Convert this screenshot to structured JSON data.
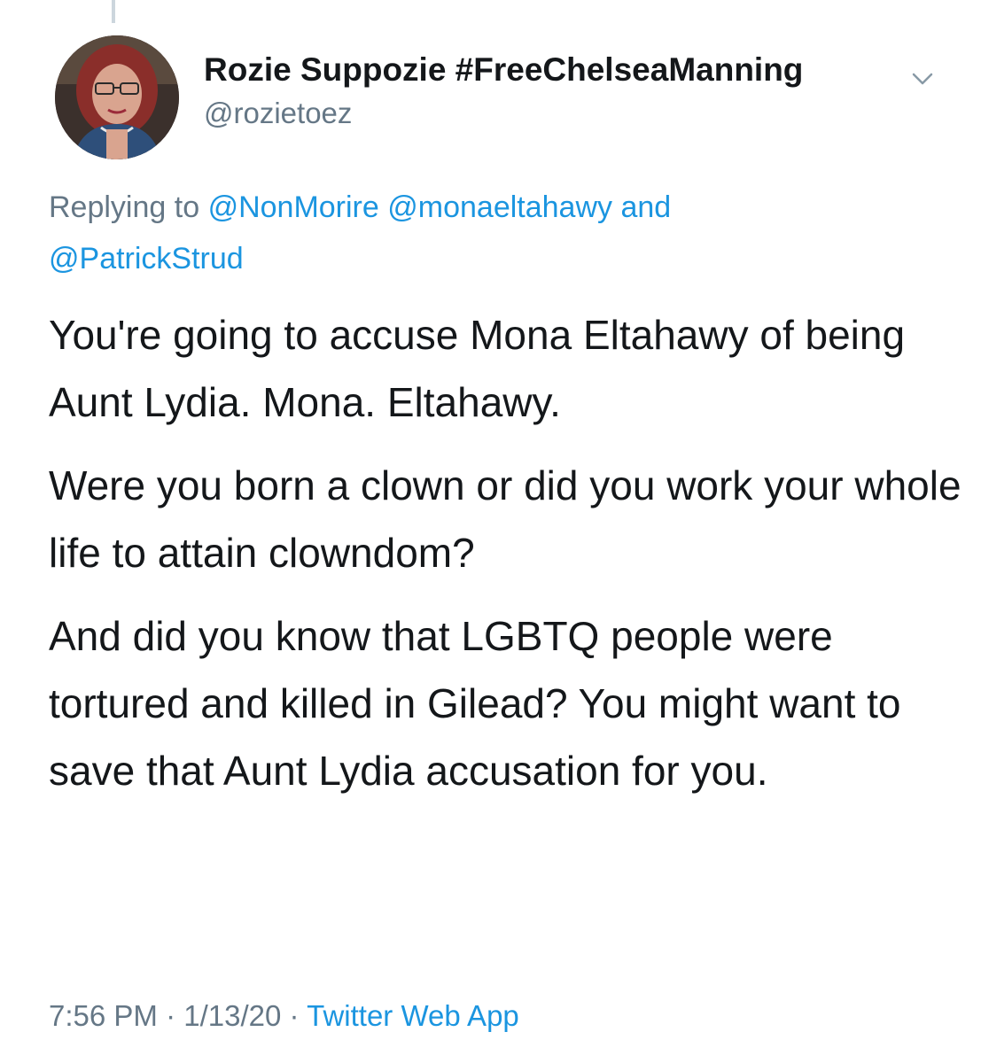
{
  "author": {
    "display_name": "Rozie Suppozie #FreeChelseaManning",
    "handle": "@rozietoez"
  },
  "reply": {
    "prefix": "Replying to",
    "mentions": [
      "@NonMorire",
      "@monaeltahawy",
      "@PatrickStrud"
    ],
    "conjunction": "and"
  },
  "tweet": {
    "paragraphs": [
      "You're going to accuse Mona Eltahawy of being Aunt Lydia. Mona. Eltahawy.",
      "Were you born a clown or did you work your whole life to attain clowndom?",
      "And did you know that LGBTQ people were tortured and killed in Gilead? You might want to save that Aunt Lydia accusation for you."
    ]
  },
  "meta": {
    "time": "7:56 PM",
    "separator": "·",
    "date": "1/13/20",
    "source": "Twitter Web App"
  },
  "icons": {
    "menu": "chevron-down-icon",
    "avatar": "profile-photo"
  },
  "colors": {
    "text": "#14171a",
    "secondary": "#657786",
    "link": "#1b95e0",
    "thread_line": "#ccd6dd"
  }
}
